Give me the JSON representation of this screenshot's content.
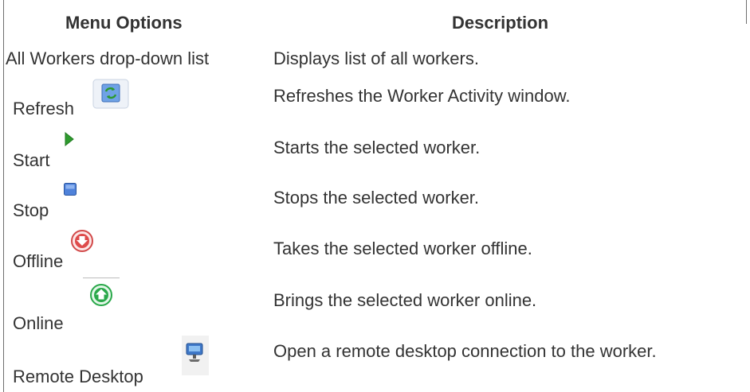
{
  "header": {
    "col1": "Menu Options",
    "col2": "Description"
  },
  "rows": [
    {
      "option": "All Workers drop-down list",
      "description": "Displays list of all workers.",
      "icon": ""
    },
    {
      "option": "Refresh",
      "description": "Refreshes the Worker Activity window.",
      "icon": "refresh-icon"
    },
    {
      "option": "Start",
      "description": "Starts the selected worker.",
      "icon": "start-icon"
    },
    {
      "option": "Stop",
      "description": "Stops the selected worker.",
      "icon": "stop-icon"
    },
    {
      "option": "Offline",
      "description": "Takes the selected worker offline.",
      "icon": "offline-icon"
    },
    {
      "option": "Online",
      "description": "Brings the selected worker online.",
      "icon": "online-icon"
    },
    {
      "option": "Remote Desktop",
      "description": "Open a remote desktop connection to the worker.",
      "icon": "remote-desktop-icon"
    }
  ],
  "colors": {
    "text": "#333333",
    "start_green": "#2e9b2e",
    "stop_blue": "#3a6fd0",
    "offline_red": "#d84040",
    "online_green": "#2aa84a"
  }
}
